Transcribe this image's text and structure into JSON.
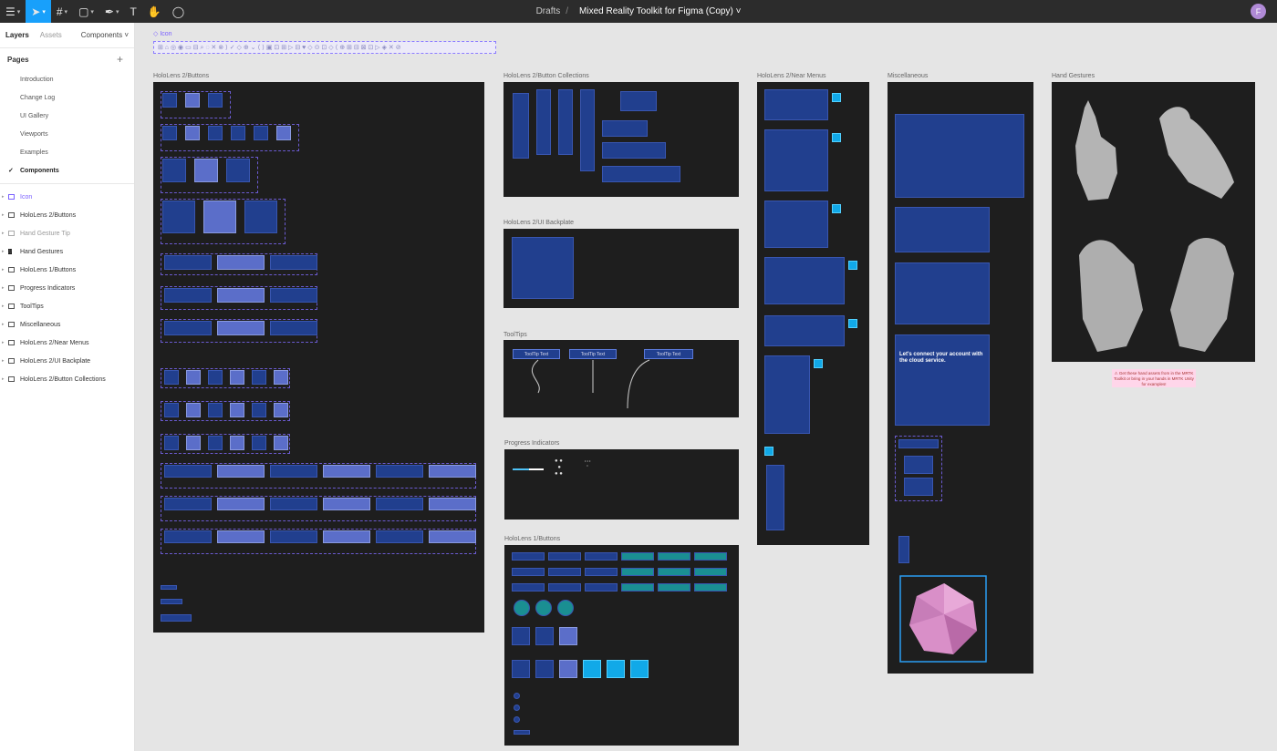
{
  "toolbar": {
    "breadcrumb": "Drafts",
    "separator": "/",
    "file_name": "Mixed Reality Toolkit for Figma (Copy) ˅",
    "avatar_initial": "F"
  },
  "panel": {
    "tabs": [
      "Layers",
      "Assets"
    ],
    "components_label": "Components ˅",
    "pages_header": "Pages",
    "add_label": "+",
    "pages": [
      "Introduction",
      "Change Log",
      "UI Gallery",
      "Viewports",
      "Examples",
      "Components"
    ],
    "current_page_mark": "✓",
    "layers": [
      "Icon",
      "HoloLens 2/Buttons",
      "Hand Gesture Tip",
      "Hand Gestures",
      "HoloLens 1/Buttons",
      "Progress Indicators",
      "ToolTips",
      "Miscellaneous",
      "HoloLens 2/Near Menus",
      "HoloLens 2/UI Backplate",
      "HoloLens 2/Button Collections"
    ]
  },
  "canvas": {
    "icon_label": "◇ Icon",
    "frames": {
      "buttons": "HoloLens 2/Buttons",
      "collections": "HoloLens 2/Button Collections",
      "backplate": "HoloLens 2/UI Backplate",
      "tooltips": "ToolTips",
      "progress": "Progress Indicators",
      "hl1": "HoloLens 1/Buttons",
      "near_menus": "HoloLens 2/Near Menus",
      "misc": "Miscellaneous",
      "gestures": "Hand Gestures"
    },
    "tooltip_text": "ToolTip Text",
    "connect_text": "Let's connect your account with the cloud service.",
    "sticky_text": "⚠ Get these hand assets from in the MRTK Toolkit or bring in your hands in MRTK Unity for examples!"
  },
  "colors": {
    "accent": "#18a0fb",
    "frame_bg": "#1e1e1e",
    "button_blue": "#213f8e",
    "selection": "#7b61ff"
  }
}
